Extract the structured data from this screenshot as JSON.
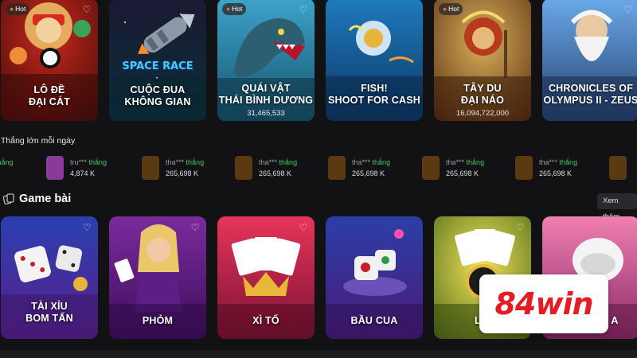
{
  "top_games": [
    {
      "title": "LÔ ĐỀ\nĐẠI CÁT",
      "hot": true,
      "amount": ""
    },
    {
      "title": "CUỘC ĐUA\nKHÔNG GIAN",
      "hot": false,
      "amount": ""
    },
    {
      "title": "QUÁI VẬT\nTHÁI BÌNH DƯƠNG",
      "hot": true,
      "amount": "31,465,533"
    },
    {
      "title": "FISH!\nSHOOT FOR CASH",
      "hot": false,
      "amount": ""
    },
    {
      "title": "TÂY DU\nĐẠI NÁO",
      "hot": true,
      "amount": "16,094,722,000"
    },
    {
      "title": "CHRONICLES OF\nOLYMPUS II - ZEUS",
      "hot": false,
      "amount": ""
    }
  ],
  "space_race_logo": "SPACE RACE",
  "hot_label": "Hot",
  "winners_title": "Thắng lớn mỗi ngày",
  "winners": [
    {
      "name": "",
      "won": "thắng",
      "amount": "K"
    },
    {
      "name": "tru***",
      "won": "thắng",
      "amount": "4,874 K"
    },
    {
      "name": "tha***",
      "won": "thắng",
      "amount": "265,698 K"
    },
    {
      "name": "tha***",
      "won": "thắng",
      "amount": "265,698 K"
    },
    {
      "name": "tha***",
      "won": "thắng",
      "amount": "265,698 K"
    },
    {
      "name": "tha***",
      "won": "thắng",
      "amount": "265,698 K"
    },
    {
      "name": "tha***",
      "won": "thắng",
      "amount": "265,698 K"
    },
    {
      "name": "",
      "won": "",
      "amount": ""
    }
  ],
  "section": {
    "title": "Game bài",
    "see_more": "Xem thêm"
  },
  "card_games": [
    {
      "title": "TÀI XỈU\nBOM TẤN"
    },
    {
      "title": "PHỎM"
    },
    {
      "title": "XÌ TỐ"
    },
    {
      "title": "BẦU CUA"
    },
    {
      "title": "LIÊ"
    },
    {
      "title": "A"
    }
  ],
  "brand": {
    "num": "84",
    "word": "win"
  },
  "colors": {
    "accent_green": "#3ec866",
    "brand_red": "#e41d24",
    "background": "#121214"
  },
  "icons": {
    "favorite": "heart-icon",
    "hot": "flame-icon",
    "section": "cards-icon"
  }
}
